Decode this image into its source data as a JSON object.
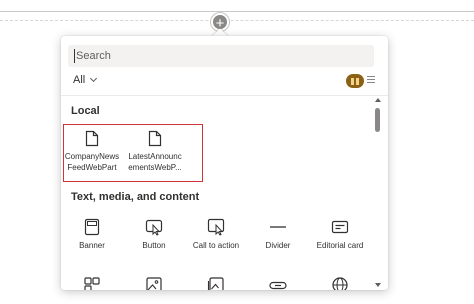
{
  "search": {
    "placeholder": "Search"
  },
  "filter": {
    "label": "All"
  },
  "sections": {
    "local": {
      "title": "Local",
      "items": [
        {
          "label_line1": "CompanyNews",
          "label_line2": "FeedWebPart",
          "icon": "document-icon"
        },
        {
          "label_line1": "LatestAnnounc",
          "label_line2": "ementsWebP...",
          "icon": "document-icon"
        }
      ]
    },
    "text_media": {
      "title": "Text, media, and content",
      "items": [
        {
          "label": "Banner",
          "icon": "banner-icon"
        },
        {
          "label": "Button",
          "icon": "button-icon"
        },
        {
          "label": "Call to action",
          "icon": "call-to-action-icon"
        },
        {
          "label": "Divider",
          "icon": "divider-icon"
        },
        {
          "label": "Editorial card",
          "icon": "editorial-card-icon"
        }
      ],
      "partial_row_icons": [
        "quick-links-icon",
        "image-icon",
        "image-gallery-icon",
        "link-icon",
        "globe-icon"
      ]
    }
  },
  "colors": {
    "accent": "#8a6115",
    "highlight_border": "#d13438"
  }
}
